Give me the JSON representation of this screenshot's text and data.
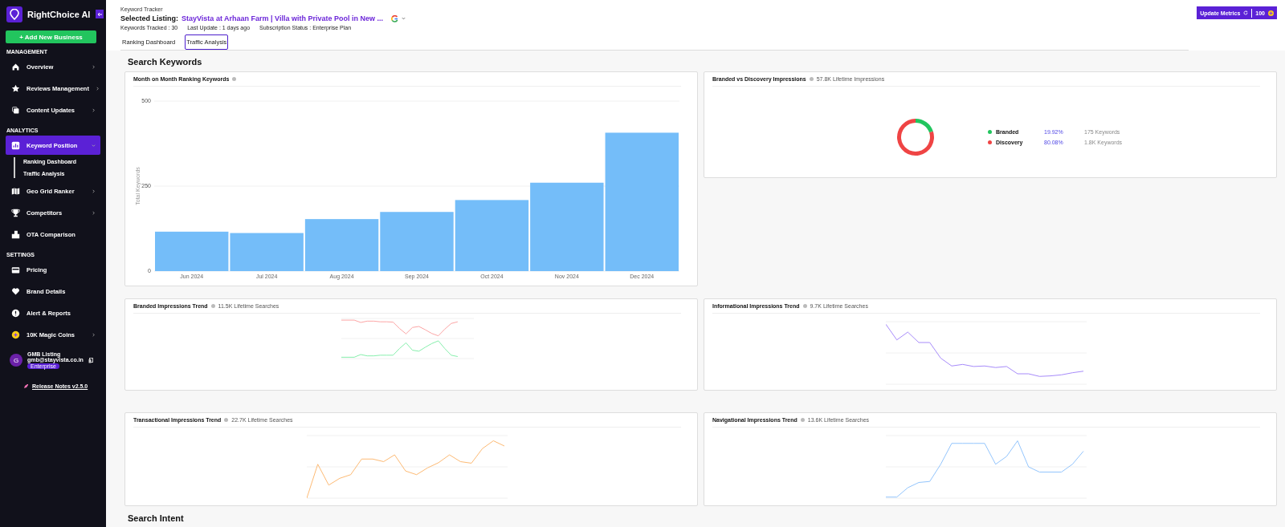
{
  "sidebar": {
    "brand": "RightChoice AI",
    "add_button": "+ Add New Business",
    "sections": [
      {
        "heading": "MANAGEMENT",
        "items": [
          {
            "label": "Overview",
            "chevron": true,
            "selected": false
          },
          {
            "label": "Reviews Management",
            "chevron": true,
            "selected": false
          },
          {
            "label": "Content Updates",
            "chevron": true,
            "selected": false
          }
        ]
      },
      {
        "heading": "ANALYTICS",
        "items": [
          {
            "label": "Keyword Position",
            "chevron": true,
            "selected": true,
            "expanded": true,
            "children": [
              {
                "label": "Ranking Dashboard"
              },
              {
                "label": "Traffic Analysis"
              }
            ]
          },
          {
            "label": "Geo Grid Ranker",
            "chevron": true,
            "selected": false
          },
          {
            "label": "Competitors",
            "chevron": true,
            "selected": false
          },
          {
            "label": "OTA Comparison",
            "chevron": false,
            "selected": false
          }
        ]
      },
      {
        "heading": "SETTINGS",
        "items": [
          {
            "label": "Pricing",
            "chevron": false,
            "selected": false
          },
          {
            "label": "Brand Details",
            "chevron": false,
            "selected": false
          },
          {
            "label": "Alert & Reports",
            "chevron": false,
            "selected": false
          },
          {
            "label": "10K Magic Coins",
            "chevron": true,
            "selected": false
          }
        ]
      }
    ],
    "profile": {
      "initial": "G",
      "name": "GMB Listing",
      "email": "gmb@stayvista.co.in",
      "plan": "Enterprise"
    },
    "release_notes": "Release Notes v2.5.0"
  },
  "header": {
    "caption": "Keyword Tracker",
    "label": "Selected Listing:",
    "listing": "StayVista at Arhaan Farm | Villa with Private Pool in New ...",
    "meta": [
      "Keywords Tracked : 30",
      "Last Update : 1 days ago",
      "Subscription Status : Enterprise Plan"
    ],
    "update_button": "Update Metrics",
    "coins": "100"
  },
  "tabs": [
    {
      "label": "Ranking Dashboard",
      "selected": false
    },
    {
      "label": "Traffic Analysis",
      "selected": true
    }
  ],
  "section_title": "Search Keywords",
  "cards": [
    {
      "kind": "bar",
      "title": "Month on Month Ranking Keywords",
      "chart_data": {
        "type": "bar",
        "ylabel": "Total Keywords",
        "categories": [
          "Jun 2024",
          "Jul 2024",
          "Aug 2024",
          "Sep 2024",
          "Oct 2024",
          "Nov 2024",
          "Dec 2024"
        ],
        "values": [
          116,
          112,
          153,
          174,
          209,
          260,
          407
        ],
        "ylim": [
          0,
          500
        ],
        "yticks": [
          0,
          250,
          500
        ]
      }
    },
    {
      "kind": "donut",
      "title": "Branded vs Discovery Impressions",
      "subtitle": "57.8K Lifetime Impressions",
      "chart_data": {
        "type": "donut",
        "categories": [
          "Branded",
          "Discovery"
        ],
        "values": [
          19.92,
          80.08
        ]
      },
      "legend": [
        {
          "color": "#22c55e",
          "percent": "19.92%",
          "keywords": "175 Keywords"
        },
        {
          "color": "#ef4444",
          "percent": "80.08%",
          "keywords": "1.8K Keywords"
        }
      ]
    },
    {
      "kind": "trend",
      "title": "Branded Impressions Trend",
      "subtitle": "11.5K Lifetime Searches"
    },
    {
      "kind": "trend",
      "title": "Informational Impressions Trend",
      "subtitle": "9.7K Lifetime Searches"
    },
    {
      "kind": "trend",
      "title": "Transactional Impressions Trend",
      "subtitle": "22.7K Lifetime Searches"
    },
    {
      "kind": "trend",
      "title": "Navigational Impressions Trend",
      "subtitle": "13.6K Lifetime Searches"
    }
  ],
  "next_section_title": "Search Intent"
}
